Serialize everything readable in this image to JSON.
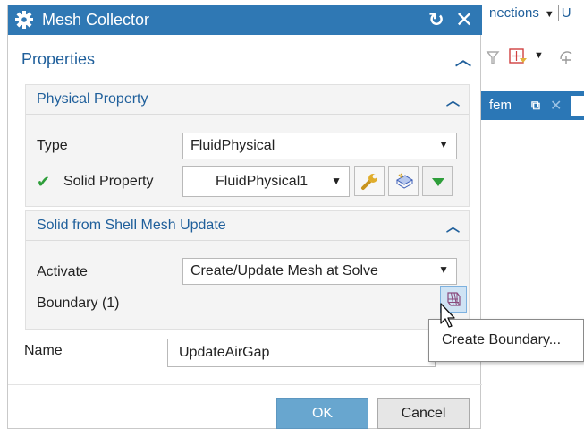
{
  "background": {
    "menu_text": "nections",
    "menu_trunc": "U",
    "tab_label": "fem"
  },
  "dialog": {
    "title": "Mesh Collector",
    "properties_header": "Properties",
    "physical_property": {
      "title": "Physical Property",
      "type_label": "Type",
      "type_value": "FluidPhysical",
      "solid_property_label": "Solid Property",
      "solid_property_value": "FluidPhysical1"
    },
    "solid_from_shell": {
      "title": "Solid from Shell Mesh Update",
      "activate_label": "Activate",
      "activate_value": "Create/Update Mesh at Solve",
      "boundary_label": "Boundary (1)"
    },
    "name_label": "Name",
    "name_value": "UpdateAirGap",
    "ok_label": "OK",
    "cancel_label": "Cancel"
  },
  "tooltip": {
    "text": "Create Boundary..."
  },
  "colors": {
    "title_bar": "#2f78b4",
    "section_header": "#1f5f9b",
    "ok_button": "#68a6cf",
    "check_green": "#2e9e3a"
  }
}
